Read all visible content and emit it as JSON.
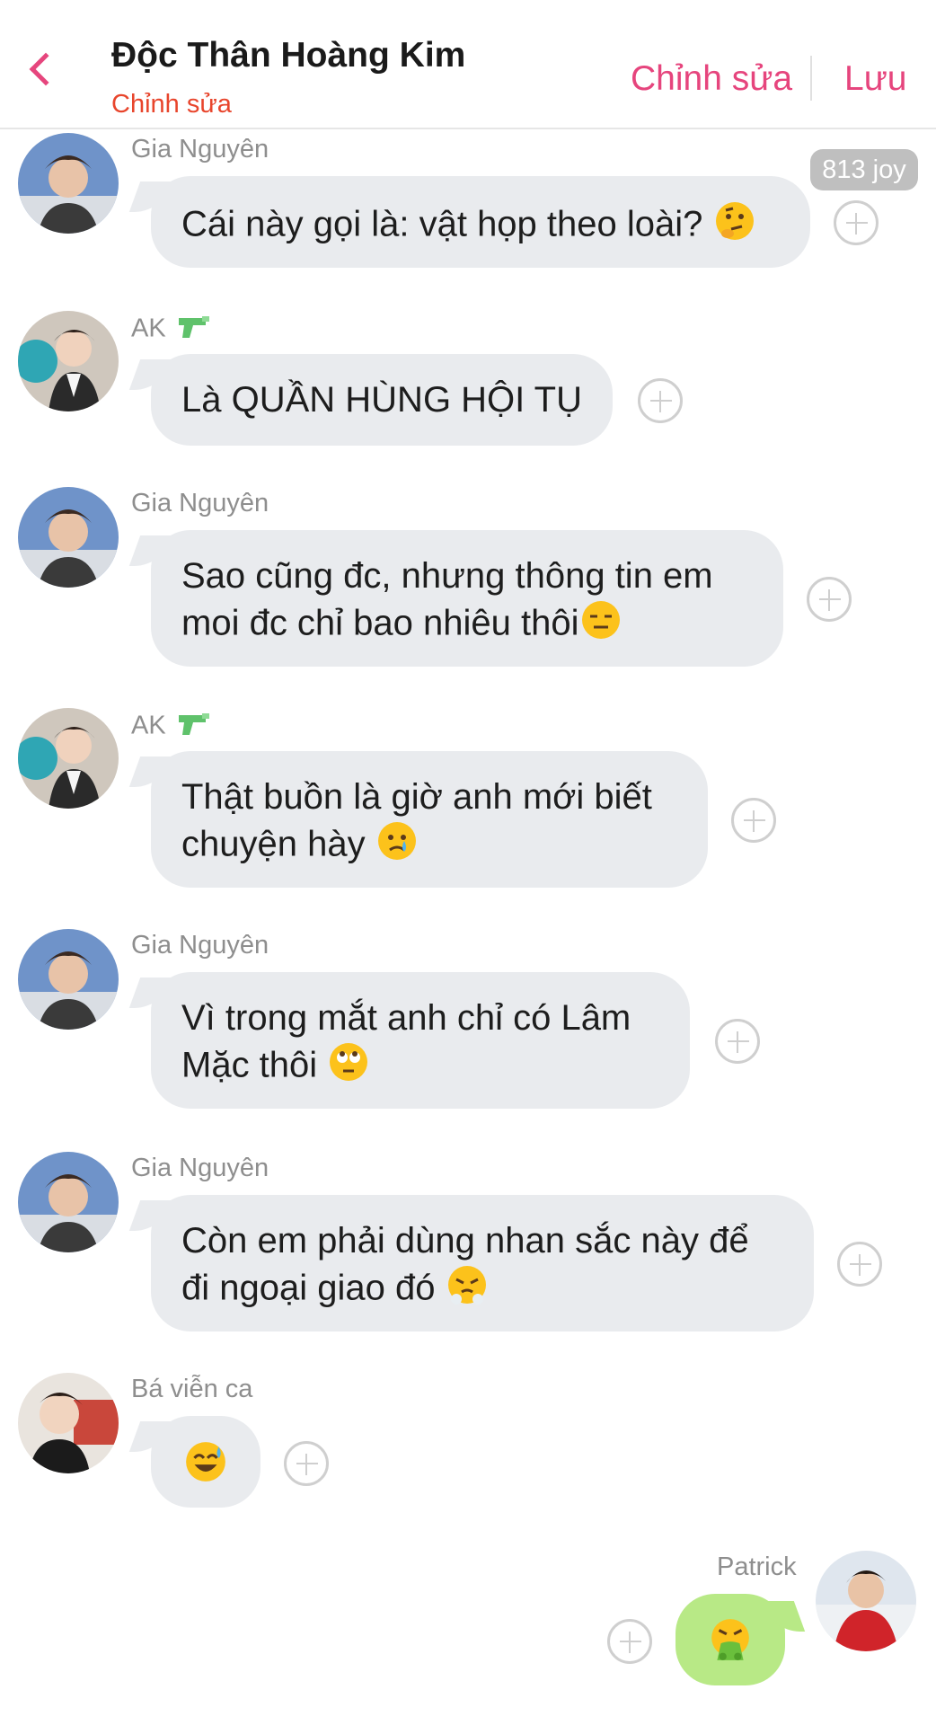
{
  "header": {
    "title": "Độc Thân Hoàng Kim",
    "subtitle": "Chỉnh sửa",
    "edit_label": "Chỉnh sửa",
    "save_label": "Lưu",
    "accent_color": "#e6457d",
    "subtitle_color": "#e8452c"
  },
  "joy_badge": "813 joy",
  "messages": [
    {
      "sender": "Gia Nguyên",
      "line1": "Cái này gọi là: vật họp theo loài?",
      "emoji": "thinking-face"
    },
    {
      "sender": "AK",
      "sender_icon": "water-gun",
      "line1": "Là QUẦN HÙNG HỘI TỤ"
    },
    {
      "sender": "Gia Nguyên",
      "line1": "Sao cũng đc, nhưng thông tin em",
      "line2": "moi đc chỉ bao nhiêu thôi",
      "emoji": "expressionless-face"
    },
    {
      "sender": "AK",
      "sender_icon": "water-gun",
      "line1": "Thật buồn là giờ anh mới biết",
      "line2": "chuyện hày",
      "emoji": "crying-face"
    },
    {
      "sender": "Gia Nguyên",
      "line1": "Vì trong mắt anh chỉ có Lâm",
      "line2": "Mặc thôi",
      "emoji": "eye-roll-face"
    },
    {
      "sender": "Gia Nguyên",
      "line1": "Còn em phải dùng nhan sắc này để",
      "line2": "đi ngoại giao đó",
      "emoji": "steam-nose-face"
    },
    {
      "sender": "Bá viễn ca",
      "emoji": "sweat-smile-face"
    },
    {
      "sender": "Patrick",
      "emoji": "vomiting-face",
      "own": true
    }
  ],
  "colors": {
    "bubble_gray": "#e9ebee",
    "bubble_green": "#b8e986"
  }
}
